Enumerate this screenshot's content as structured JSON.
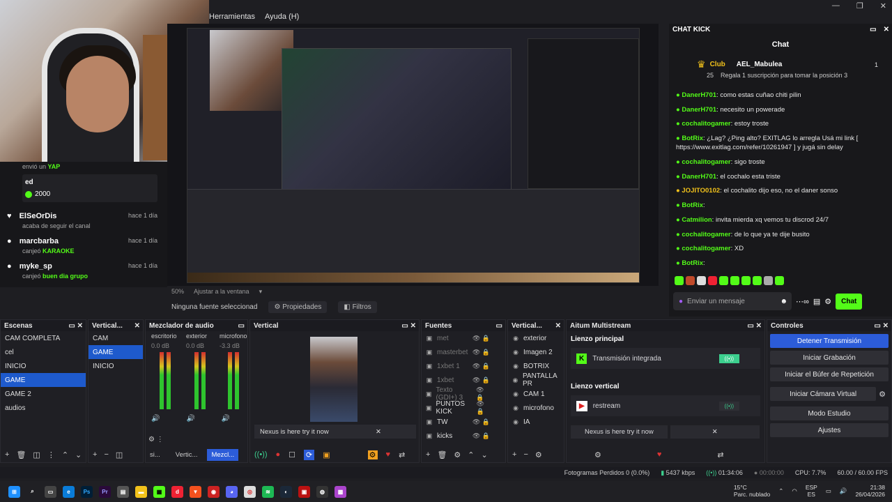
{
  "menubar": {
    "items": [
      "Herramientas",
      "Ayuda (H)"
    ]
  },
  "preview": {
    "zoom": "50%",
    "fit_label": "Ajustar a la ventana"
  },
  "source_bar": {
    "no_source": "Ninguna fuente seleccionad",
    "properties": "Propiedades",
    "filters": "Filtros"
  },
  "feed": {
    "sent_prefix": "envió un",
    "sent_item": "YAP",
    "gift_title": "ed",
    "gift_amount": "2000",
    "events": [
      {
        "name": "ElSeOrDis",
        "text": "acaba de seguir el canal",
        "highlight": "",
        "time": "hace 1 día"
      },
      {
        "name": "marcbarba",
        "text": "canjeó",
        "highlight": "KARAOKE",
        "time": "hace 1 día"
      },
      {
        "name": "myke_sp",
        "text": "canjeó",
        "highlight": "buen dia grupo",
        "time": "hace 1 día"
      }
    ]
  },
  "chat": {
    "panel_title": "CHAT KICK",
    "title": "Chat",
    "pinned": {
      "club": "Club",
      "rank": "25",
      "user": "AEL_Mabulea",
      "count": "1",
      "text": "Regala 1 suscripción para tomar la posición 3"
    },
    "messages": [
      {
        "user": "DanerH701",
        "color": "#53fc18",
        "text": "como estas cuñao chiti pilin"
      },
      {
        "user": "DanerH701",
        "color": "#53fc18",
        "text": "necesito un powerade"
      },
      {
        "user": "cochalitogamer",
        "color": "#53fc18",
        "text": "estoy troste"
      },
      {
        "user": "BotRix",
        "color": "#53fc18",
        "text": "¿Lag? ¿Ping alto? EXITLAG lo arregla  Usá mi link  [ https://www.exitlag.com/refer/10261947 ] y jugá sin delay"
      },
      {
        "user": "cochalitogamer",
        "color": "#53fc18",
        "text": "sigo troste"
      },
      {
        "user": "DanerH701",
        "color": "#53fc18",
        "text": "el cochalo esta triste"
      },
      {
        "user": "JOJITO0102",
        "color": "#f2c21b",
        "text": "el cochalito dijo eso, no el daner sonso"
      },
      {
        "user": "BotRix",
        "color": "#53fc18",
        "text": ""
      },
      {
        "user": "Catmilion",
        "color": "#53fc18",
        "text": "invita mierda xq vemos tu discrod 24/7"
      },
      {
        "user": "cochalitogamer",
        "color": "#53fc18",
        "text": "de lo que ya te dije busito"
      },
      {
        "user": "cochalitogamer",
        "color": "#53fc18",
        "text": "XD"
      },
      {
        "user": "BotRix",
        "color": "#53fc18",
        "text": ""
      }
    ],
    "input_placeholder": "Enviar un mensaje",
    "send_label": "Chat"
  },
  "docks": {
    "scenes": {
      "title": "Escenas",
      "items": [
        "CAM COMPLETA",
        "cel",
        "INICIO",
        "GAME",
        "GAME 2",
        "audios"
      ],
      "selected": 3
    },
    "vertical_scenes": {
      "title": "Vertical...",
      "items": [
        "CAM",
        "GAME",
        "INICIO"
      ],
      "selected": 1
    },
    "mixer": {
      "title": "Mezclador de audio",
      "channels": [
        {
          "name": "escritorio",
          "db": "0.0 dB"
        },
        {
          "name": "exterior",
          "db": "0.0 dB"
        },
        {
          "name": "microfono",
          "db": "-3.3 dB"
        }
      ],
      "tabs": [
        "si...",
        "Vertic...",
        "Mezcl..."
      ]
    },
    "vertical_preview": {
      "title": "Vertical",
      "nexus": "Nexus is here try it now"
    },
    "sources": {
      "title": "Fuentes",
      "items": [
        "met",
        "masterbet",
        "1xbet 1",
        "1xbet",
        "Texto (GDI+) 3",
        "PUNTOS KICK",
        "TW",
        "kicks"
      ],
      "dimmed": [
        0,
        1,
        2,
        3,
        4
      ]
    },
    "vertical_sources": {
      "title": "Vertical...",
      "items": [
        "exterior",
        "Imagen 2",
        "BOTRIX",
        "PANTALLA PR",
        "CAM 1",
        "microfono",
        "IA"
      ]
    },
    "multistream": {
      "title": "Aitum Multistream",
      "main_canvas": "Lienzo principal",
      "integrated": "Transmisión integrada",
      "vertical_canvas": "Lienzo vertical",
      "restream": "restream",
      "nexus": "Nexus is here try it now"
    },
    "controls": {
      "title": "Controles",
      "buttons": [
        "Detener Transmisión",
        "Iniciar Grabación",
        "Iniciar el Búfer de Repetición",
        "Iniciar Cámara Virtual",
        "Modo Estudio",
        "Ajustes"
      ]
    }
  },
  "status": {
    "dropped": "Fotogramas Perdidos 0 (0.0%)",
    "kbps": "5437 kbps",
    "stream_time": "01:34:06",
    "rec_time": "00:00:00",
    "cpu": "CPU: 7.7%",
    "fps": "60.00 / 60.00 FPS"
  },
  "taskbar": {
    "weather_temp": "15°C",
    "weather_desc": "Parc. nublado",
    "lang1": "ESP",
    "lang2": "ES",
    "time": "21:38",
    "date": "26/04/2026"
  },
  "colors": {
    "accent": "#2c5cd8",
    "kick_green": "#53fc18"
  }
}
